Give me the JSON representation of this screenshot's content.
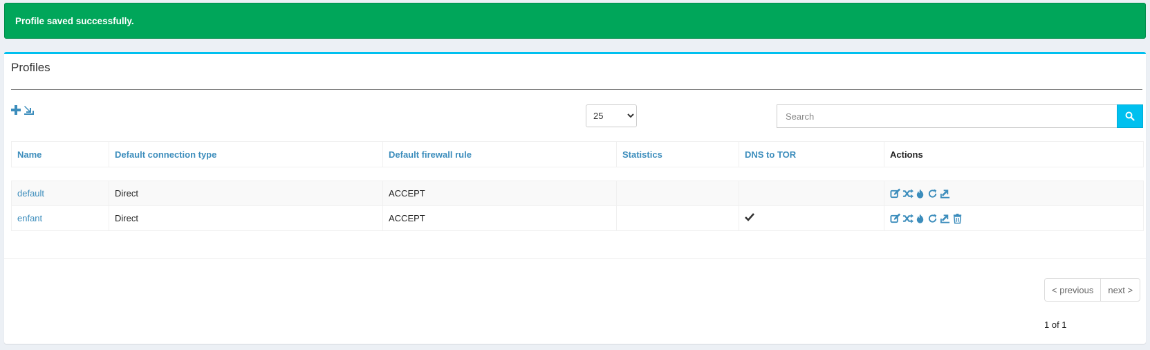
{
  "alert": {
    "message": "Profile saved successfully."
  },
  "box": {
    "title": "Profiles"
  },
  "toolbar": {
    "add_icon": "plus-icon",
    "import_icon": "import-icon"
  },
  "page_size": {
    "selected": "25",
    "options": [
      "25"
    ]
  },
  "search": {
    "placeholder": "Search",
    "icon": "search-icon"
  },
  "table": {
    "headers": {
      "name": "Name",
      "connection": "Default connection type",
      "firewall": "Default firewall rule",
      "statistics": "Statistics",
      "dns": "DNS to TOR",
      "actions": "Actions"
    },
    "rows": [
      {
        "name": "default",
        "connection": "Direct",
        "firewall": "ACCEPT",
        "statistics": "",
        "dns_to_tor": false
      },
      {
        "name": "enfant",
        "connection": "Direct",
        "firewall": "ACCEPT",
        "statistics": "",
        "dns_to_tor": true
      }
    ]
  },
  "pagination": {
    "previous": "< previous",
    "next": "next >",
    "info": "1 of 1"
  },
  "colors": {
    "success": "#00a65a",
    "accent": "#00c0ef",
    "link": "#3c8dbc"
  }
}
